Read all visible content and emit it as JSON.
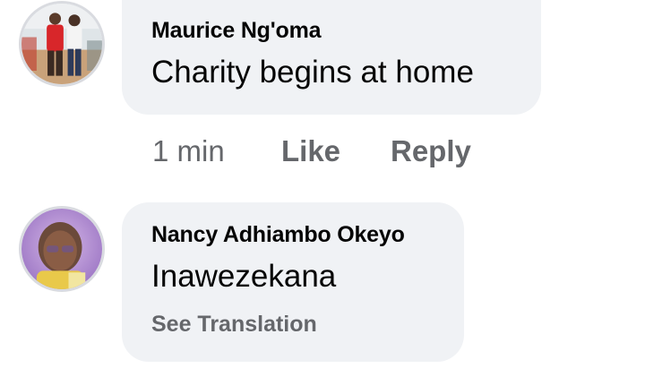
{
  "comments": [
    {
      "author": "Maurice Ng'oma",
      "text": "Charity begins at home",
      "time": "1 min",
      "like_label": "Like",
      "reply_label": "Reply"
    },
    {
      "author": "Nancy Adhiambo Okeyo",
      "text": "Inawezekana",
      "translate_label": "See Translation"
    }
  ],
  "colors": {
    "bubble_bg": "#f0f2f5",
    "primary_text": "#050505",
    "secondary_text": "#65676b"
  }
}
